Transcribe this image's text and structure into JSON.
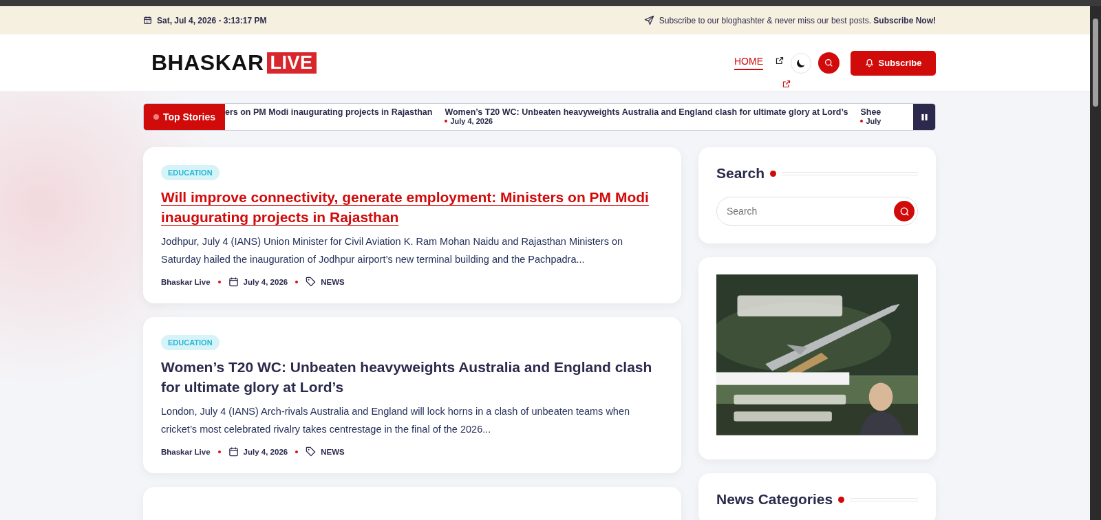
{
  "top_bar": {
    "datetime": "Sat, Jul 4, 2026 - 3:13:17 PM",
    "subscribe_text": "Subscribe to our bloghashter & never miss our best posts. **Subscribe Now!**"
  },
  "header": {
    "logo": {
      "part_1": "BHASKAR",
      "part_2": "LIVE"
    },
    "nav": [
      {
        "label": "HOME",
        "selected": true
      }
    ],
    "subscribe_button": "Subscribe"
  },
  "ticker": {
    "label": "Top Stories",
    "items": [
      {
        "title": "ers on PM Modi inaugurating projects in Rajasthan"
      },
      {
        "title": "Women’s T20 WC: Unbeaten heavyweights Australia and England clash for ultimate glory at Lord’s",
        "date": "July 4, 2026"
      },
      {
        "title": "Shee",
        "date": "July"
      }
    ]
  },
  "posts": [
    {
      "category": "EDUCATION",
      "title": "Will improve connectivity, generate employment: Ministers on PM Modi inaugurating projects in Rajasthan",
      "hovered": true,
      "excerpt": "Jodhpur, July 4 (IANS) Union Minister for Civil Aviation K. Ram Mohan Naidu and Rajasthan Ministers on Saturday hailed the inauguration of Jodhpur airport’s new terminal building and the Pachpadra...",
      "author": "Bhaskar Live",
      "date": "July 4, 2026",
      "tag": "NEWS"
    },
    {
      "category": "EDUCATION",
      "title": "Women’s T20 WC: Unbeaten heavyweights Australia and England clash for ultimate glory at Lord’s",
      "hovered": false,
      "excerpt": "London, July 4 (IANS) Arch-rivals Australia and England will lock horns in a clash of unbeaten teams when cricket’s most celebrated rivalry takes centrestage in the final of the 2026...",
      "author": "Bhaskar Live",
      "date": "July 4, 2026",
      "tag": "NEWS"
    }
  ],
  "sidebar": {
    "search": {
      "title": "Search",
      "placeholder": "Search"
    },
    "categories": {
      "title": "News Categories"
    }
  }
}
